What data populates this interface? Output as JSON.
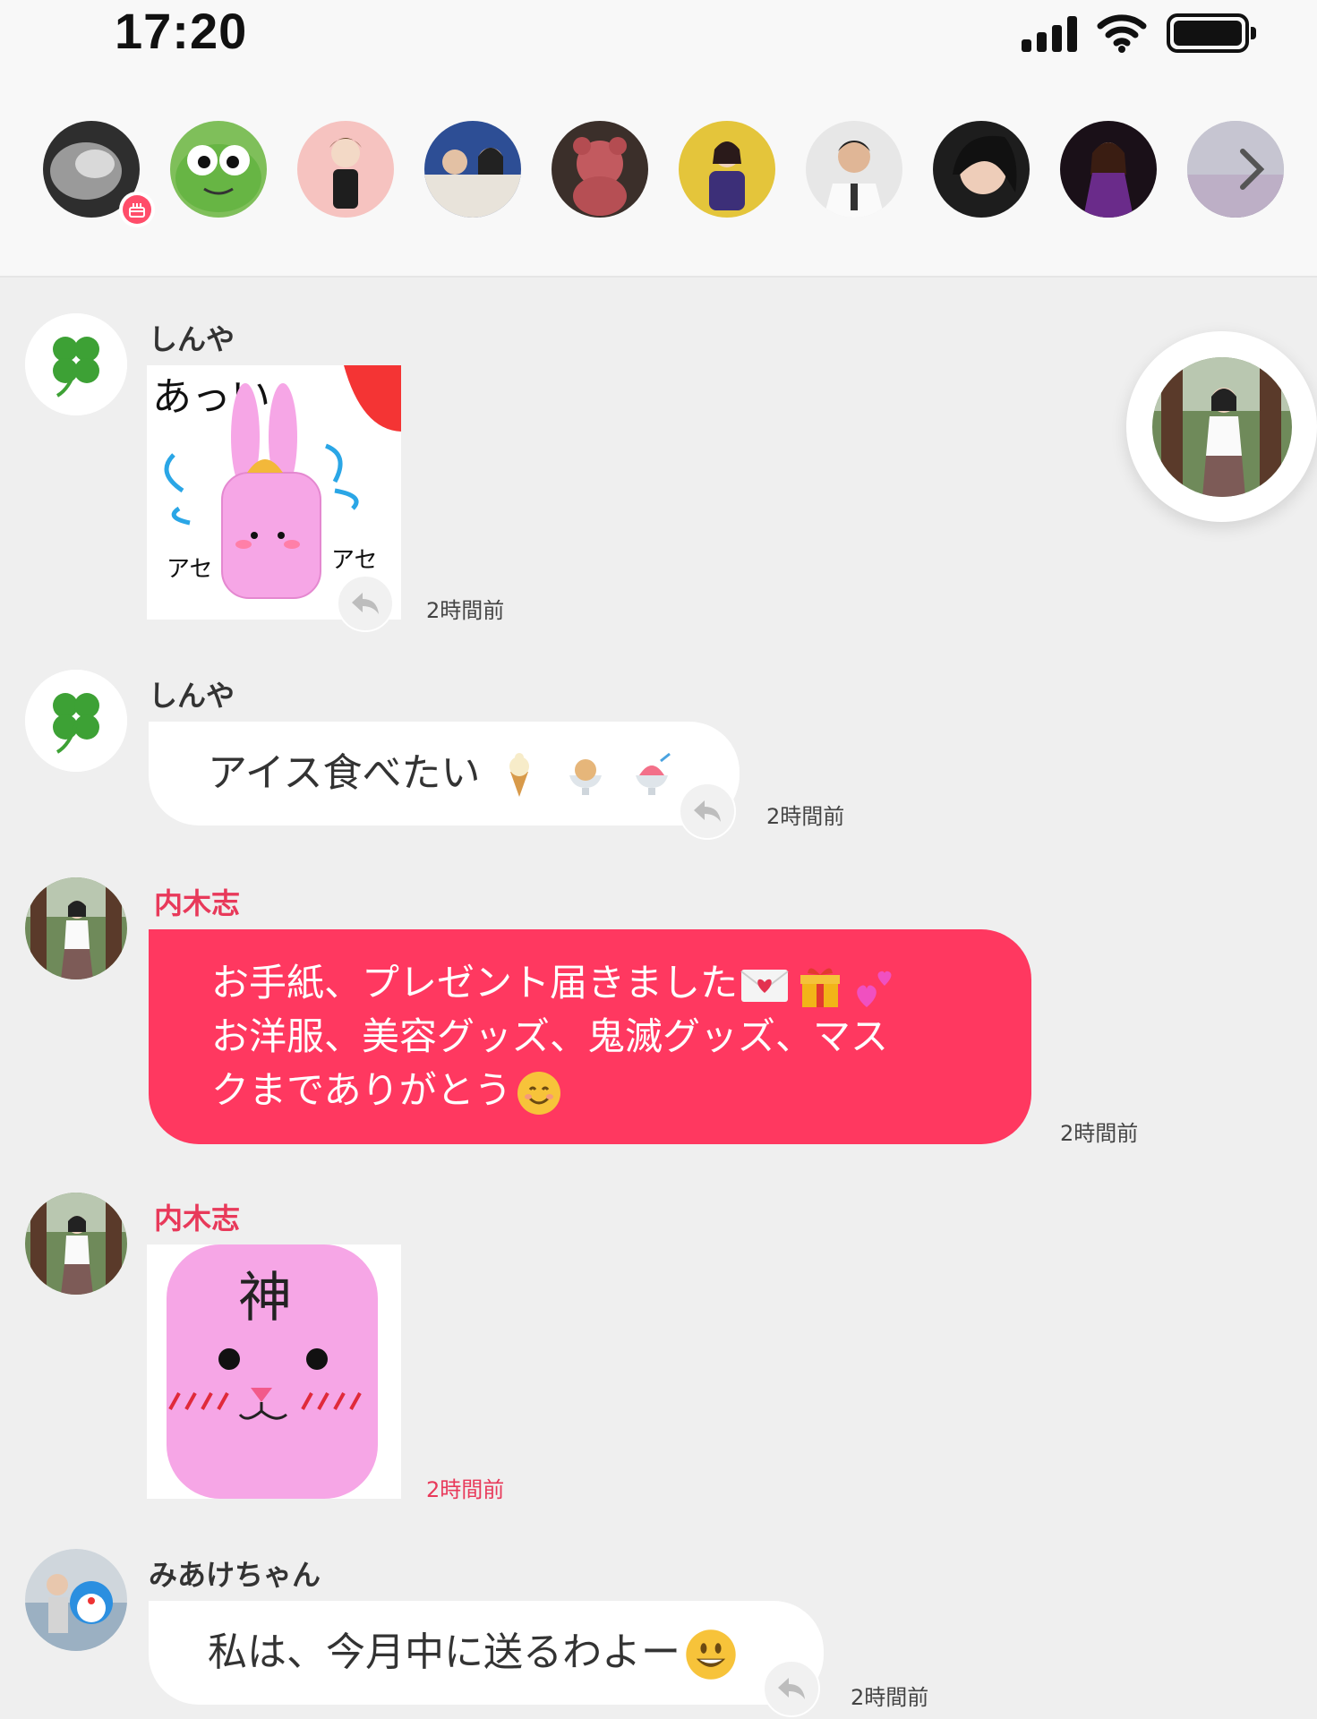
{
  "status_bar": {
    "time": "17:20"
  },
  "stories": [
    {
      "name": "story-1",
      "color": "#6d6d6d"
    },
    {
      "name": "story-2",
      "color": "#61b443"
    },
    {
      "name": "story-3",
      "color": "#f7c6c4"
    },
    {
      "name": "story-4",
      "color": "#3f5fa8"
    },
    {
      "name": "story-5",
      "color": "#4a3a34"
    },
    {
      "name": "story-6",
      "color": "#e8c73a"
    },
    {
      "name": "story-7",
      "color": "#c9c9c9"
    },
    {
      "name": "story-8",
      "color": "#2b2b2b"
    },
    {
      "name": "story-9",
      "color": "#3a2130"
    },
    {
      "name": "story-10",
      "color": "#8a8aa0"
    }
  ],
  "messages": [
    {
      "type": "sticker",
      "name": "しんや",
      "time": "2時間前",
      "sticker_text": [
        "あっい",
        "アセ",
        "アセ"
      ]
    },
    {
      "type": "text",
      "name": "しんや",
      "text": "アイス食べたい",
      "time": "2時間前"
    },
    {
      "type": "text-highlight",
      "name": "内木志",
      "lines": [
        "お手紙、プレゼント届きました",
        "お洋服、美容グッズ、鬼滅グッズ、マス",
        "クまでありがとう"
      ],
      "time": "2時間前"
    },
    {
      "type": "sticker",
      "name": "内木志",
      "time": "2時間前",
      "sticker_text": [
        "神"
      ]
    },
    {
      "type": "text",
      "name": "みあけちゃん",
      "text": "私は、今月中に送るわよー",
      "time": "2時間前"
    }
  ],
  "colors": {
    "accent": "#ff3860",
    "accent_text": "#e8395a",
    "background": "#efefef"
  }
}
